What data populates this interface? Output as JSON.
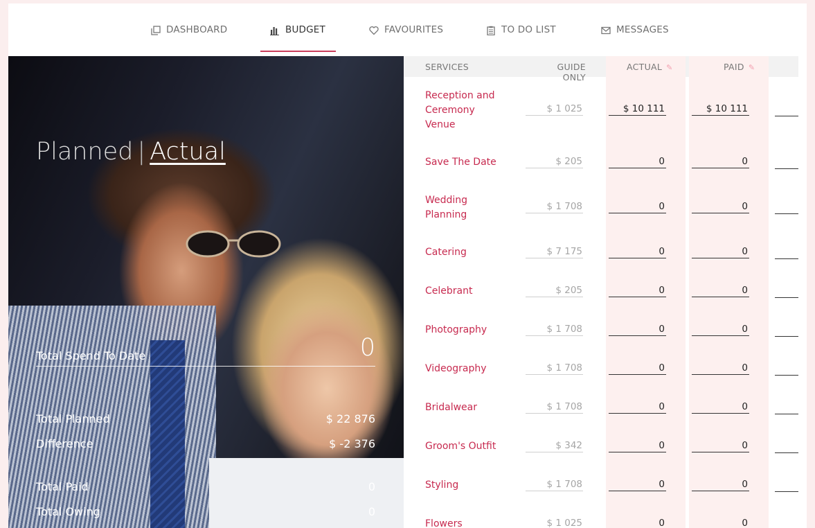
{
  "nav": {
    "items": [
      {
        "label": "DASHBOARD",
        "icon": "copy-icon"
      },
      {
        "label": "BUDGET",
        "icon": "bar-chart-icon"
      },
      {
        "label": "FAVOURITES",
        "icon": "heart-icon"
      },
      {
        "label": "TO DO LIST",
        "icon": "clipboard-icon"
      },
      {
        "label": "MESSAGES",
        "icon": "mail-icon"
      }
    ],
    "active": "BUDGET"
  },
  "summary": {
    "toggle_planned": "Planned",
    "toggle_sep": "|",
    "toggle_actual": "Actual",
    "total_spend_label": "Total Spend To Date",
    "total_spend_value": "0",
    "total_planned_label": "Total Planned",
    "total_planned_value": "$ 22 876",
    "difference_label": "Difference",
    "difference_value": "$ -2 376",
    "total_paid_label": "Total Paid",
    "total_paid_value": "0",
    "total_owing_label": "Total Owing",
    "total_owing_value": "0"
  },
  "table": {
    "headers": {
      "services": "SERVICES",
      "guide": "GUIDE ONLY",
      "actual": "ACTUAL",
      "paid": "PAID"
    },
    "rows": [
      {
        "service": "Reception and Ceremony Venue",
        "guide": "$ 1 025",
        "actual": "$ 10 111",
        "paid": "$ 10 111"
      },
      {
        "service": "Save The Date",
        "guide": "$ 205",
        "actual": "0",
        "paid": "0"
      },
      {
        "service": "Wedding Planning",
        "guide": "$ 1 708",
        "actual": "0",
        "paid": "0"
      },
      {
        "service": "Catering",
        "guide": "$ 7 175",
        "actual": "0",
        "paid": "0"
      },
      {
        "service": "Celebrant",
        "guide": "$ 205",
        "actual": "0",
        "paid": "0"
      },
      {
        "service": "Photography",
        "guide": "$ 1 708",
        "actual": "0",
        "paid": "0"
      },
      {
        "service": "Videography",
        "guide": "$ 1 708",
        "actual": "0",
        "paid": "0"
      },
      {
        "service": "Bridalwear",
        "guide": "$ 1 708",
        "actual": "0",
        "paid": "0"
      },
      {
        "service": "Groom's Outfit",
        "guide": "$ 342",
        "actual": "0",
        "paid": "0"
      },
      {
        "service": "Styling",
        "guide": "$ 1 708",
        "actual": "0",
        "paid": "0"
      },
      {
        "service": "Flowers",
        "guide": "$ 1 025",
        "actual": "0",
        "paid": "0"
      }
    ]
  },
  "colors": {
    "accent": "#c72a4f",
    "highlight_column": "#fdf0ef",
    "page_bg": "#fbeeee"
  }
}
